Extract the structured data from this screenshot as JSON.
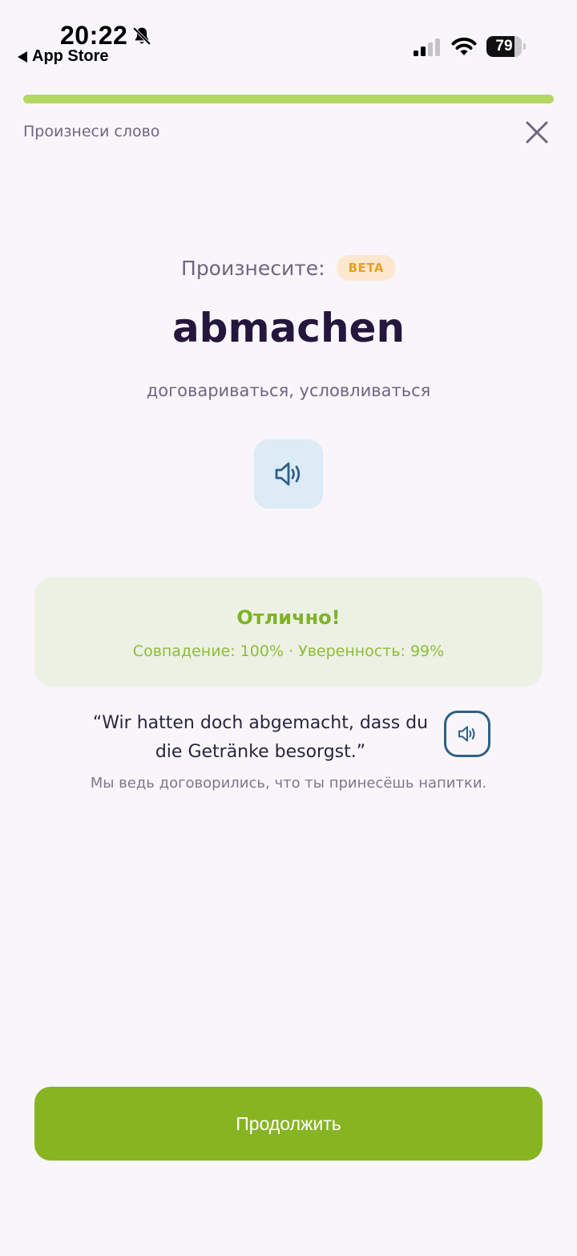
{
  "status_bar": {
    "time": "20:22",
    "back_label": "App Store",
    "battery_level": "79",
    "icons": [
      "bell-off-icon",
      "signal-icon",
      "wifi-icon",
      "battery-icon"
    ]
  },
  "header": {
    "title": "Произнеси слово",
    "progress": 1.0,
    "close_icon": "close-icon"
  },
  "prompt": {
    "label": "Произнесите:",
    "badge": "BETA"
  },
  "word": {
    "text": "abmachen",
    "translation": "договариваться, условливаться",
    "audio_icon": "speaker-icon"
  },
  "result": {
    "title": "Отлично!",
    "stats": "Совпадение: 100% · Уверенность: 99%"
  },
  "example": {
    "sentence": "“Wir hatten doch abgemacht, dass du die Getränke besorgst.”",
    "translation": "Мы ведь договорились, что ты принесёшь напитки.",
    "audio_icon": "speaker-icon"
  },
  "actions": {
    "continue_label": "Продолжить"
  },
  "colors": {
    "background": "#f8f6fa",
    "accent_green": "#87b522",
    "progress_green": "#b2d961",
    "success_text": "#7fb228",
    "beta_bg": "#fde8cf",
    "beta_text": "#e6a021",
    "audio_bg": "#dcebf6",
    "audio_icon": "#2f6085"
  }
}
